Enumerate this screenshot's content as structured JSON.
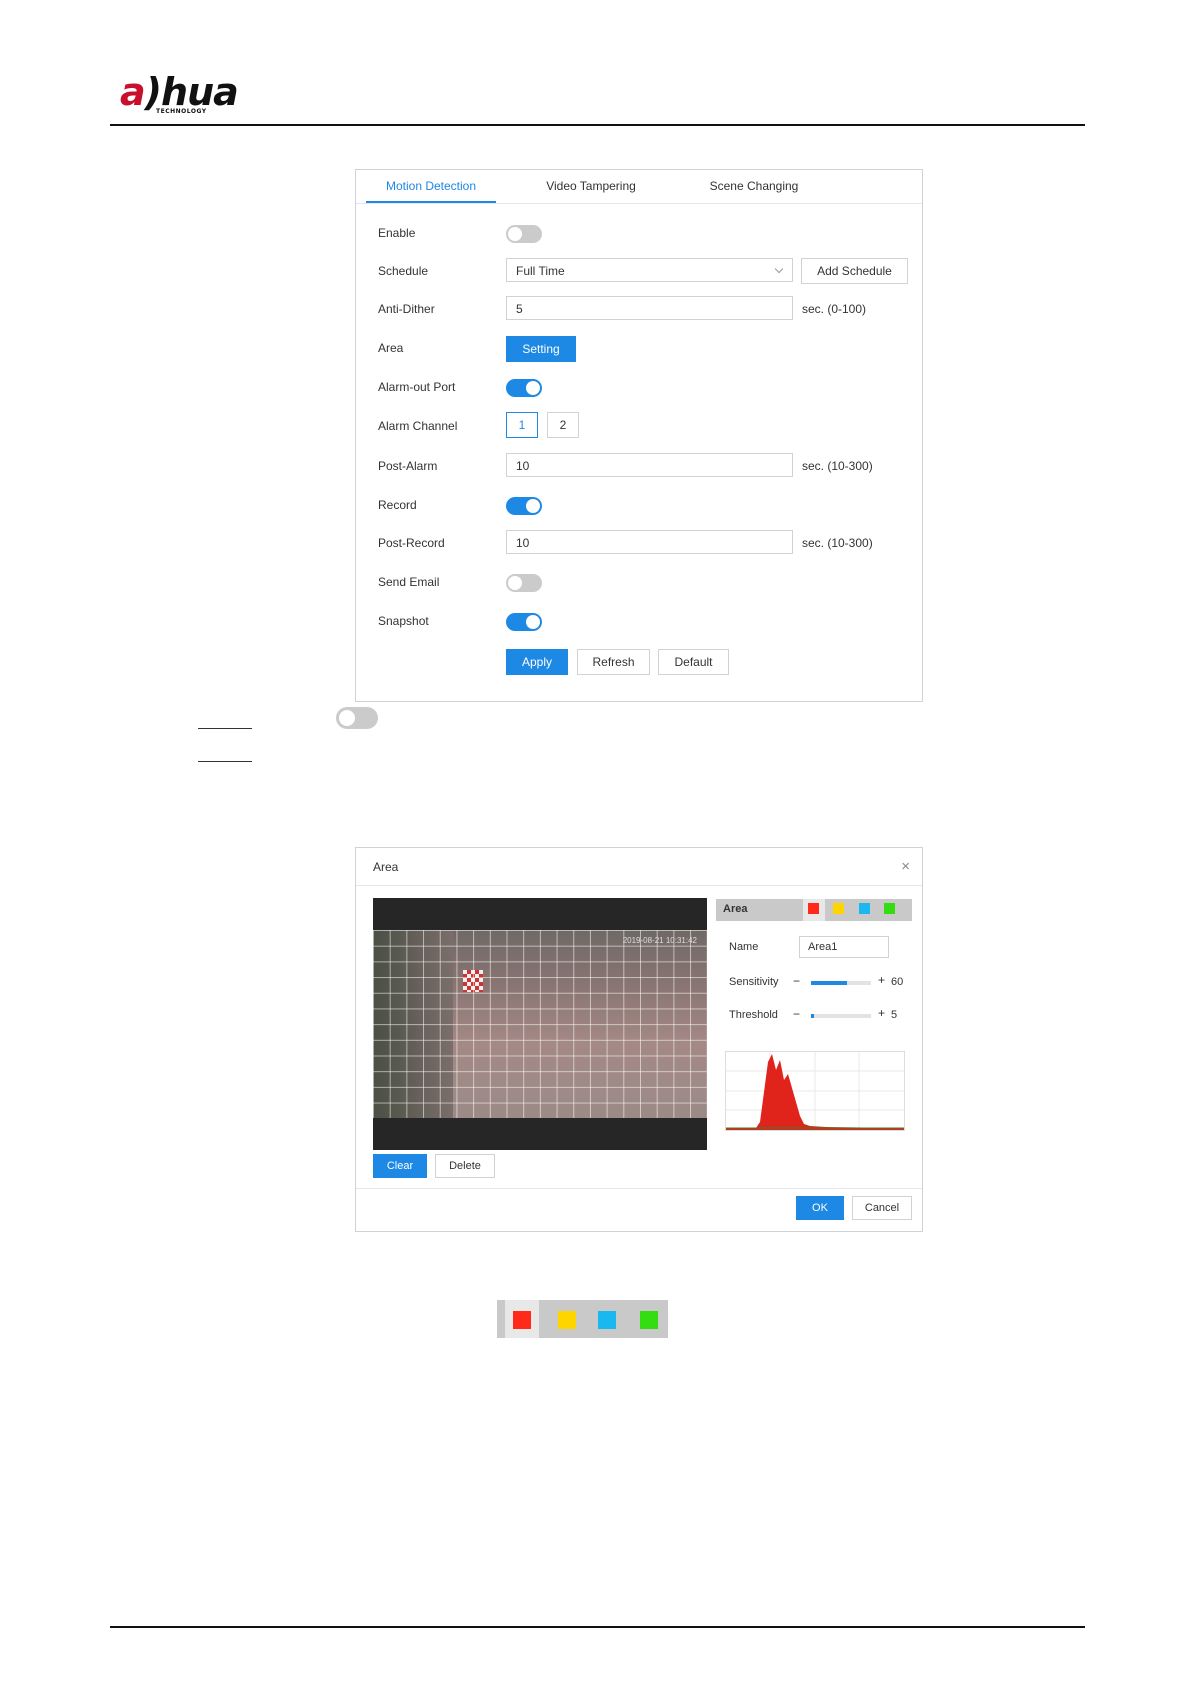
{
  "header": {
    "logo_text": "alhua",
    "logo_sub": "TECHNOLOGY"
  },
  "tabs": [
    "Motion Detection",
    "Video Tampering",
    "Scene Changing"
  ],
  "form": {
    "enable_label": "Enable",
    "enable_on": false,
    "schedule_label": "Schedule",
    "schedule_value": "Full Time",
    "add_schedule": "Add Schedule",
    "antidither_label": "Anti-Dither",
    "antidither_value": "5",
    "antidither_unit": "sec. (0-100)",
    "area_label": "Area",
    "setting_btn": "Setting",
    "alarmout_label": "Alarm-out Port",
    "alarmout_on": true,
    "alarmchannel_label": "Alarm Channel",
    "channels": [
      "1",
      "2"
    ],
    "channel_selected": "1",
    "postalarm_label": "Post-Alarm",
    "postalarm_value": "10",
    "postalarm_unit": "sec. (10-300)",
    "record_label": "Record",
    "record_on": true,
    "postrecord_label": "Post-Record",
    "postrecord_value": "10",
    "postrecord_unit": "sec. (10-300)",
    "sendemail_label": "Send Email",
    "sendemail_on": false,
    "snapshot_label": "Snapshot",
    "snapshot_on": true,
    "apply": "Apply",
    "refresh": "Refresh",
    "default": "Default"
  },
  "area_dialog": {
    "title": "Area",
    "close": "×",
    "panel_label": "Area",
    "name_label": "Name",
    "name_value": "Area1",
    "sensitivity_label": "Sensitivity",
    "sensitivity_value": "60",
    "sensitivity_fraction": 0.6,
    "threshold_label": "Threshold",
    "threshold_value": "5",
    "threshold_fraction": 0.05,
    "minus": "−",
    "plus": "+",
    "clear": "Clear",
    "delete": "Delete",
    "ok": "OK",
    "cancel": "Cancel",
    "osd_text": "2019-08-21 10:31:42"
  },
  "colors": {
    "accent": "#1e88e5",
    "area_colors": [
      "#ff2a1a",
      "#ffd500",
      "#1ab8f0",
      "#33dd11"
    ]
  }
}
